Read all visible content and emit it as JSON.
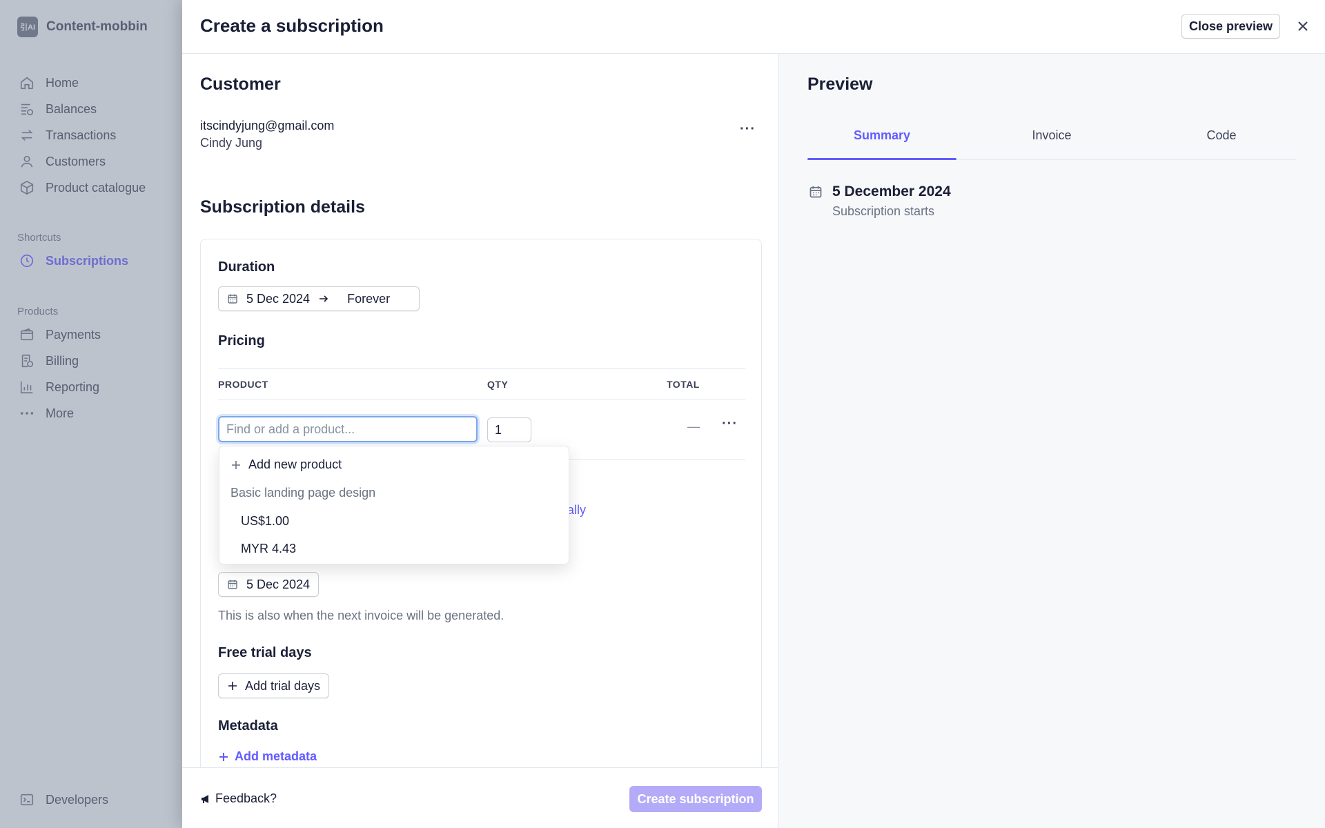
{
  "sidebar": {
    "brand_logo_text": "引AI",
    "brand": "Content-mobbin",
    "nav": [
      {
        "label": "Home",
        "icon": "home-icon"
      },
      {
        "label": "Balances",
        "icon": "balances-icon"
      },
      {
        "label": "Transactions",
        "icon": "transactions-icon"
      },
      {
        "label": "Customers",
        "icon": "customers-icon"
      },
      {
        "label": "Product catalogue",
        "icon": "box-icon"
      }
    ],
    "shortcuts_label": "Shortcuts",
    "shortcut": "Subscriptions",
    "products_label": "Products",
    "products": [
      {
        "label": "Payments",
        "icon": "wallet-icon"
      },
      {
        "label": "Billing",
        "icon": "billing-icon"
      },
      {
        "label": "Reporting",
        "icon": "chart-icon"
      },
      {
        "label": "More",
        "icon": "more-icon"
      }
    ],
    "developers": "Developers"
  },
  "modal": {
    "title": "Create a subscription",
    "close_preview": "Close preview",
    "customer": {
      "heading": "Customer",
      "email": "itscindyjung@gmail.com",
      "name": "Cindy Jung"
    },
    "details": {
      "heading": "Subscription details",
      "duration_label": "Duration",
      "duration_start": "5 Dec 2024",
      "duration_end": "Forever",
      "pricing_label": "Pricing",
      "columns": {
        "product": "PRODUCT",
        "qty": "QTY",
        "total": "TOTAL"
      },
      "product_placeholder": "Find or add a product...",
      "qty_value": "1",
      "total_value": "—",
      "partial_link": "ally",
      "billing_date": "5 Dec 2024",
      "billing_helper": "This is also when the next invoice will be generated.",
      "trial_label": "Free trial days",
      "add_trial": "Add trial days",
      "metadata_label": "Metadata",
      "add_metadata": "Add metadata"
    },
    "dropdown": {
      "add_new": "Add new product",
      "group": "Basic landing page design",
      "options": [
        "US$1.00",
        "MYR 4.43"
      ]
    },
    "footer": {
      "feedback": "Feedback?",
      "create": "Create subscription"
    }
  },
  "preview": {
    "heading": "Preview",
    "tabs": [
      "Summary",
      "Invoice",
      "Code"
    ],
    "active_tab": "Summary",
    "summary_date": "5 December 2024",
    "summary_sub": "Subscription starts"
  },
  "colors": {
    "accent": "#635bff",
    "create_button_disabled": "#b3abf8",
    "focus_ring": "#7aa8e8"
  }
}
